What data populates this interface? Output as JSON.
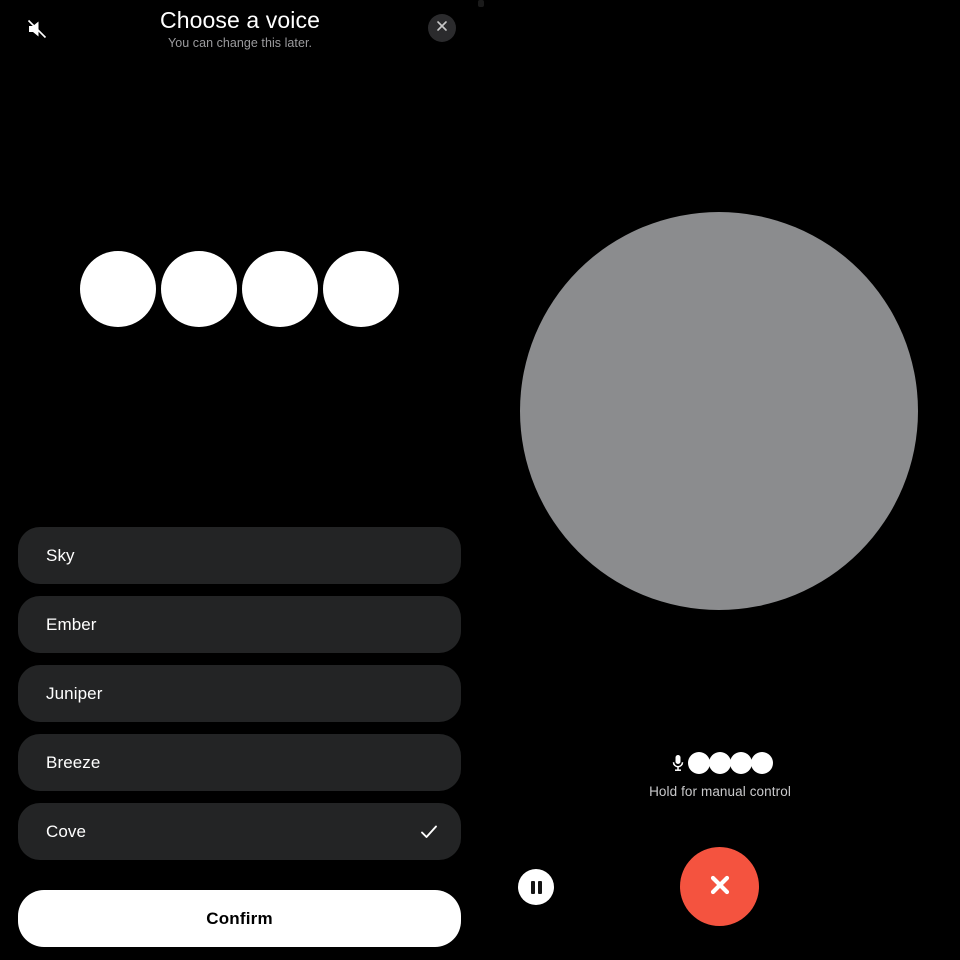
{
  "left_panel": {
    "mute_icon": "speaker-muted-icon",
    "title": "Choose a voice",
    "subtitle": "You can change this later.",
    "close_icon": "close-icon",
    "orb_preview": {
      "icon": "voice-orb-preview",
      "count": 4,
      "color": "#ffffff"
    },
    "voices": [
      {
        "label": "Sky",
        "selected": false
      },
      {
        "label": "Ember",
        "selected": false
      },
      {
        "label": "Juniper",
        "selected": false
      },
      {
        "label": "Breeze",
        "selected": false
      },
      {
        "label": "Cove",
        "selected": true
      }
    ],
    "selected_voice": "Cove",
    "check_icon": "checkmark-icon",
    "confirm_label": "Confirm",
    "row_color": "#232425",
    "confirm_color": "#ffffff"
  },
  "right_panel": {
    "orb_color": "#8b8c8e",
    "mic_icon": "microphone-icon",
    "mic_dot_count": 4,
    "hold_hint": "Hold for manual control",
    "pause_icon": "pause-icon",
    "end_call_icon": "close-icon",
    "end_call_color": "#f4533f"
  }
}
